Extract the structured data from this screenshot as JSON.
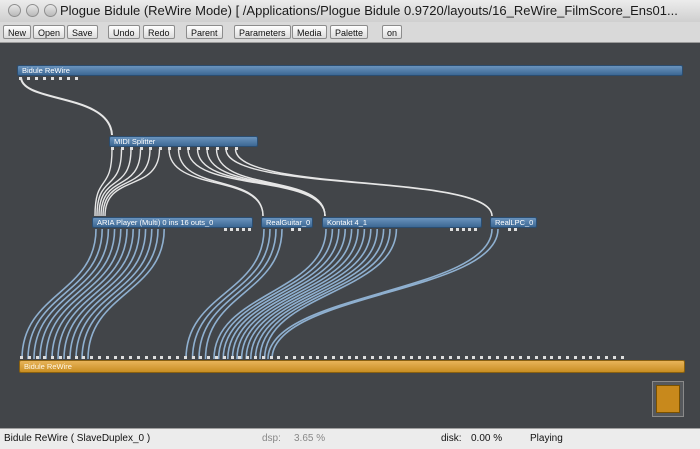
{
  "window": {
    "title": "Plogue Bidule (ReWire Mode) [ /Applications/Plogue Bidule 0.9720/layouts/16_ReWire_FilmScore_Ens01...",
    "controls": [
      "close-button",
      "minimize-button",
      "zoom-button"
    ]
  },
  "toolbar": {
    "new": "New",
    "open": "Open",
    "save": "Save",
    "undo": "Undo",
    "redo": "Redo",
    "parent": "Parent",
    "parameters": "Parameters",
    "media": "Media",
    "palette": "Palette",
    "on": "on"
  },
  "nodes": {
    "rewire_in": "Bidule ReWire",
    "midi_splitter": "MIDI Splitter",
    "aria_player": "ARIA Player (Multi) 0 ins 16 outs_0",
    "real_guitar": "RealGuitar_0",
    "kontakt": "Kontakt 4_1",
    "real_lpc": "RealLPC_0",
    "rewire_out": "Bidule ReWire"
  },
  "colors": {
    "canvas": "#424549",
    "node_blue": "#4f7aa6",
    "node_orange": "#d9a030",
    "wire_blue": "#8fb0d0",
    "wire_white": "#e6e6e6"
  },
  "status": {
    "device": "Bidule ReWire ( SlaveDuplex_0 )",
    "dsp_label": "dsp:",
    "dsp_value": "3.65 %",
    "disk_label": "disk:",
    "disk_value": "0.00 %",
    "state": "Playing"
  }
}
